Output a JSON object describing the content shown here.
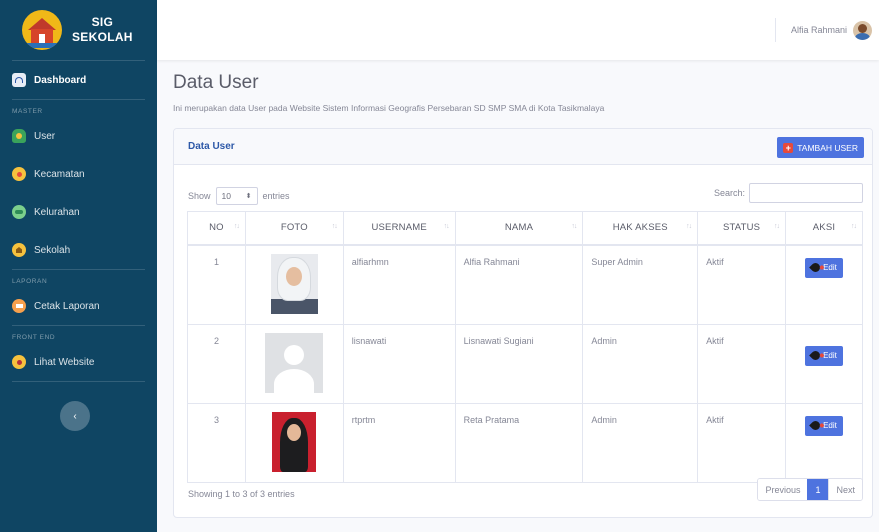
{
  "brand": {
    "line1": "SIG",
    "line2": "SEKOLAH"
  },
  "sidebar": {
    "dashboard": "Dashboard",
    "heading_master": "MASTER",
    "user": "User",
    "kecamatan": "Kecamatan",
    "kelurahan": "Kelurahan",
    "sekolah": "Sekolah",
    "heading_laporan": "LAPORAN",
    "cetak_laporan": "Cetak Laporan",
    "heading_front": "FRONT END",
    "lihat_website": "Lihat Website",
    "toggle": "‹"
  },
  "topbar": {
    "user_name": "Alfia Rahmani"
  },
  "page": {
    "title": "Data User",
    "subtitle": "Ini merupakan data User pada Website Sistem Informasi Geografis Persebaran SD SMP SMA di Kota Tasikmalaya"
  },
  "card": {
    "title": "Data User",
    "add_button": "TAMBAH USER",
    "show_label": "Show",
    "entries_value": "10",
    "entries_label": "entries",
    "search_label": "Search:"
  },
  "table": {
    "headers": [
      "NO",
      "FOTO",
      "USERNAME",
      "NAMA",
      "HAK AKSES",
      "STATUS",
      "AKSI"
    ],
    "rows": [
      {
        "no": "1",
        "username": "alfiarhmn",
        "nama": "Alfia Rahmani",
        "hak_akses": "Super Admin",
        "status": "Aktif",
        "action": "Edit"
      },
      {
        "no": "2",
        "username": "lisnawati",
        "nama": "Lisnawati Sugiani",
        "hak_akses": "Admin",
        "status": "Aktif",
        "action": "Edit"
      },
      {
        "no": "3",
        "username": "rtprtm",
        "nama": "Reta Pratama",
        "hak_akses": "Admin",
        "status": "Aktif",
        "action": "Edit"
      }
    ]
  },
  "footer": {
    "info": "Showing 1 to 3 of 3 entries",
    "previous": "Previous",
    "current_page": "1",
    "next": "Next"
  },
  "colors": {
    "sidebar": "#0f4563",
    "primary": "#4e73df",
    "danger": "#e74a3b"
  }
}
